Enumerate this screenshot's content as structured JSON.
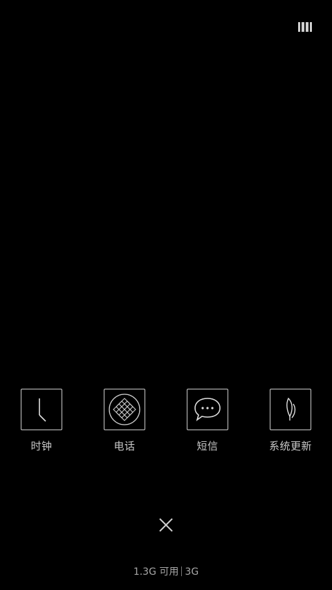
{
  "status_bar": {
    "icon": "recent-grid-icon"
  },
  "apps": [
    {
      "label": "时钟",
      "icon": "clock-icon"
    },
    {
      "label": "电话",
      "icon": "dialpad-icon"
    },
    {
      "label": "短信",
      "icon": "message-bubble-icon"
    },
    {
      "label": "系统更新",
      "icon": "leaf-icon"
    }
  ],
  "close": {
    "icon": "close-icon"
  },
  "memory": {
    "available": "1.3G 可用",
    "network": "3G"
  }
}
